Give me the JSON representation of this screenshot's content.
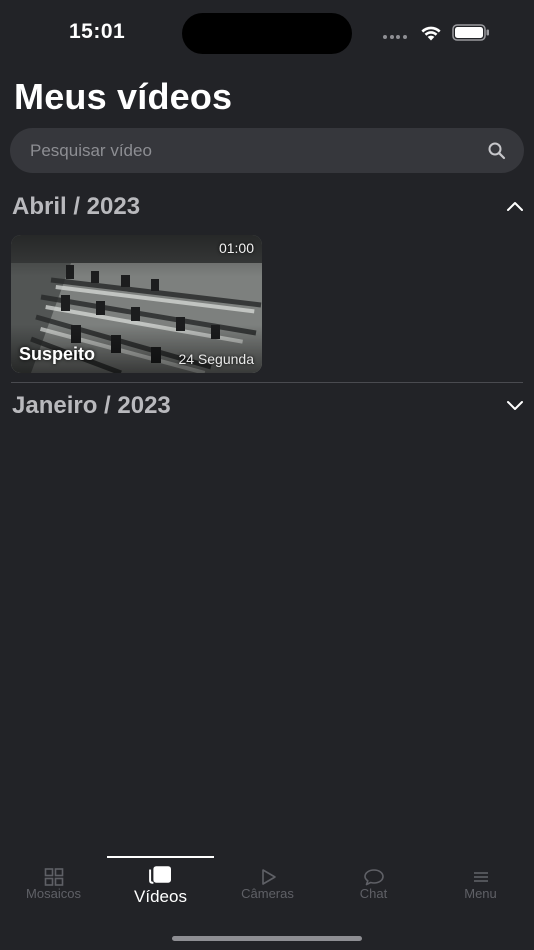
{
  "status_bar": {
    "time": "15:01"
  },
  "header": {
    "title": "Meus vídeos"
  },
  "search": {
    "placeholder": "Pesquisar vídeo",
    "value": ""
  },
  "sections": [
    {
      "title": "Abril / 2023",
      "expanded": true,
      "videos": [
        {
          "title": "Suspeito",
          "duration": "01:00",
          "date": "24 Segunda"
        }
      ]
    },
    {
      "title": "Janeiro / 2023",
      "expanded": false,
      "videos": []
    }
  ],
  "tab_bar": {
    "active": "Vídeos",
    "tabs": [
      {
        "label": "Mosaicos",
        "icon": "grid-icon"
      },
      {
        "label": "Vídeos",
        "icon": "videos-icon"
      },
      {
        "label": "Câmeras",
        "icon": "play-icon"
      },
      {
        "label": "Chat",
        "icon": "chat-bubble-icon"
      },
      {
        "label": "Menu",
        "icon": "menu-icon"
      }
    ]
  },
  "colors": {
    "background": "#222327",
    "search_background": "#36373c",
    "section_title": "#b9b9bd",
    "tab_inactive": "#5f6066",
    "tab_active": "#ffffff"
  }
}
